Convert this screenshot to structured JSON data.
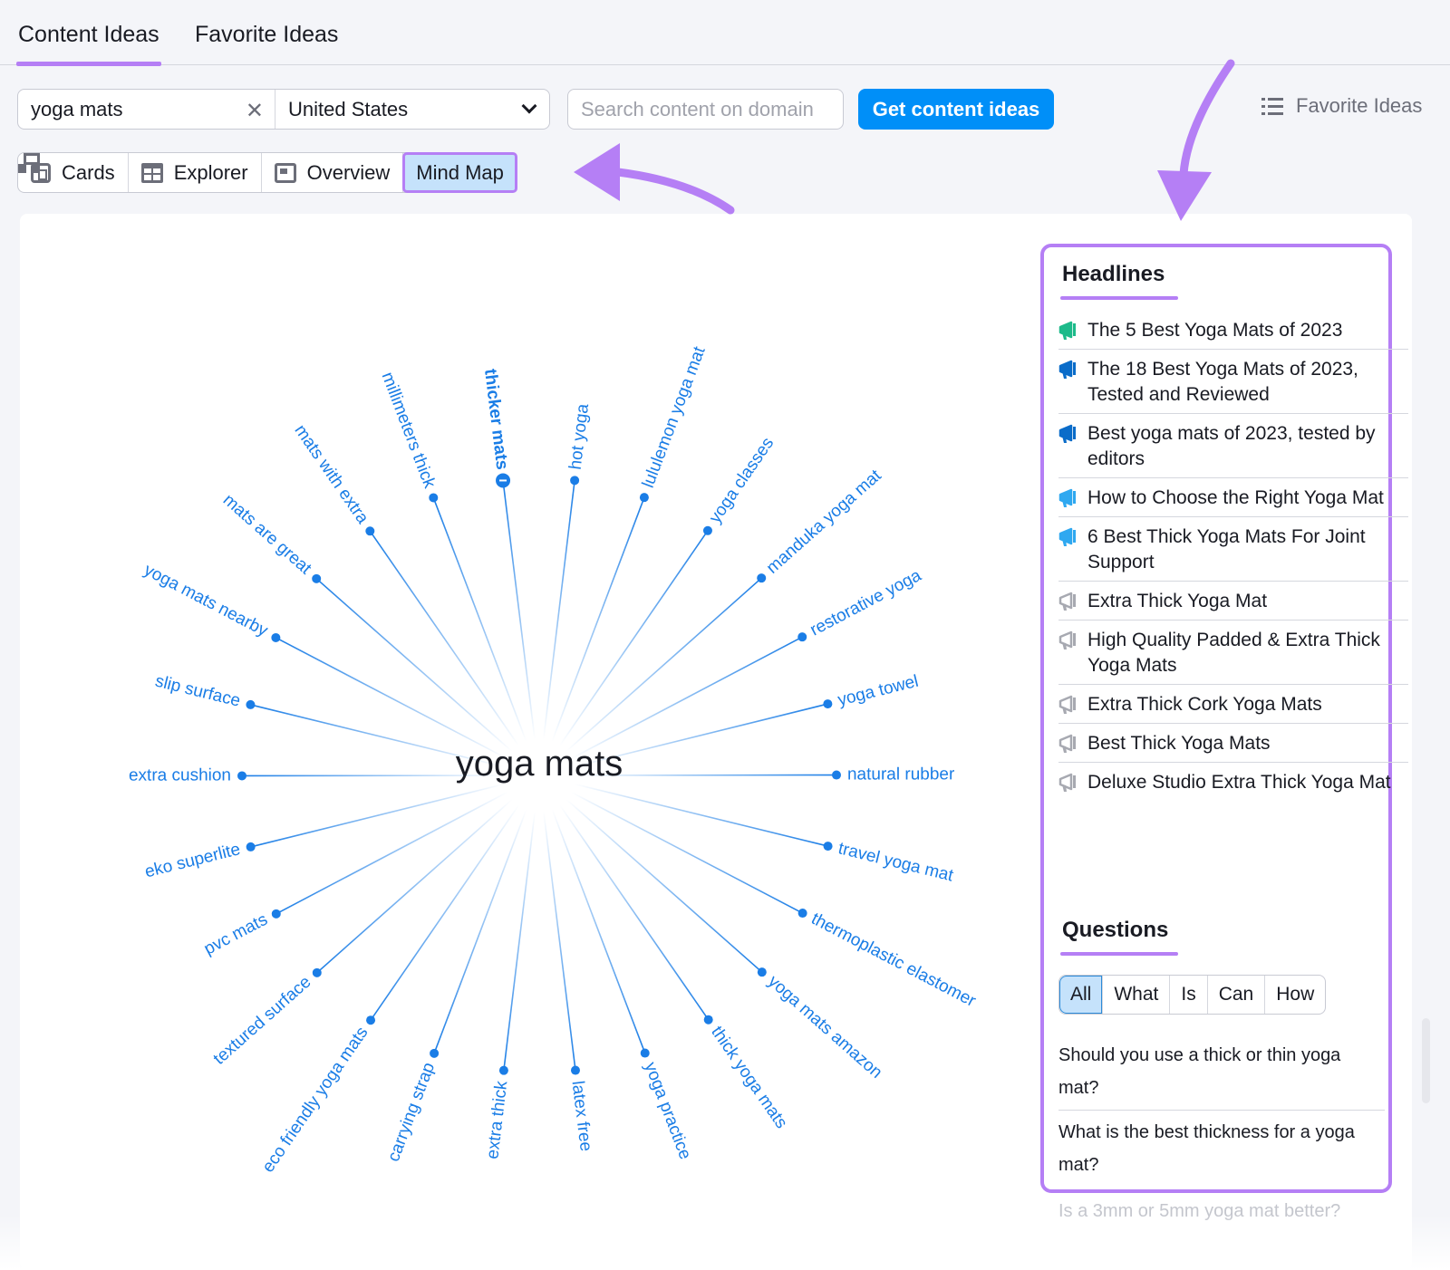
{
  "tabs": [
    {
      "label": "Content Ideas",
      "active": true
    },
    {
      "label": "Favorite Ideas",
      "active": false
    }
  ],
  "search": {
    "keyword": "yoga mats",
    "country": "United States",
    "domain_placeholder": "Search content on domain",
    "submit_label": "Get content ideas"
  },
  "favorite_link": {
    "label": "Favorite Ideas",
    "icon": "list-icon"
  },
  "views": [
    {
      "label": "Cards",
      "icon": "cards-icon",
      "active": false
    },
    {
      "label": "Explorer",
      "icon": "table-icon",
      "active": false
    },
    {
      "label": "Overview",
      "icon": "overview-icon",
      "active": false
    },
    {
      "label": "Mind Map",
      "icon": "mind-map-icon",
      "active": true
    }
  ],
  "annotation_color": "#b57ff5",
  "mindmap": {
    "center": "yoga mats",
    "node_color": "#1a7de6",
    "expanded_node": "thicker mats",
    "nodes": [
      "thicker mats",
      "hot yoga",
      "lululemon yoga mat",
      "yoga classes",
      "manduka yoga mat",
      "restorative yoga",
      "yoga towel",
      "natural rubber",
      "travel yoga mat",
      "thermoplastic elastomer",
      "yoga mats amazon",
      "thick yoga mats",
      "yoga practice",
      "latex free",
      "extra thick",
      "carrying strap",
      "eco friendly yoga mats",
      "textured surface",
      "pvc mats",
      "eko superlite",
      "extra cushion",
      "slip surface",
      "yoga mats nearby",
      "mats are great",
      "mats with extra",
      "millimeters thick"
    ]
  },
  "headlines": {
    "title": "Headlines",
    "items": [
      {
        "text": "The 5 Best Yoga Mats of 2023",
        "icon_color": "#1dba8a"
      },
      {
        "text": "The 18 Best Yoga Mats of 2023, Tested and Reviewed",
        "icon_color": "#0a6cc9"
      },
      {
        "text": "Best yoga mats of 2023, tested by editors",
        "icon_color": "#0a6cc9"
      },
      {
        "text": "How to Choose the Right Yoga Mat",
        "icon_color": "#2fa8f0"
      },
      {
        "text": "6 Best Thick Yoga Mats For Joint Support",
        "icon_color": "#2fa8f0"
      },
      {
        "text": "Extra Thick Yoga Mat",
        "icon_color": "#a7a9b1"
      },
      {
        "text": "High Quality Padded & Extra Thick Yoga Mats",
        "icon_color": "#a7a9b1"
      },
      {
        "text": "Extra Thick Cork Yoga Mats",
        "icon_color": "#a7a9b1"
      },
      {
        "text": "Best Thick Yoga Mats",
        "icon_color": "#a7a9b1"
      },
      {
        "text": "Deluxe Studio Extra Thick Yoga Mat",
        "icon_color": "#a7a9b1"
      }
    ]
  },
  "questions": {
    "title": "Questions",
    "filters": [
      {
        "label": "All",
        "active": true
      },
      {
        "label": "What",
        "active": false
      },
      {
        "label": "Is",
        "active": false
      },
      {
        "label": "Can",
        "active": false
      },
      {
        "label": "How",
        "active": false
      }
    ],
    "items": [
      "Should you use a thick or thin yoga mat?",
      "What is the best thickness for a yoga mat?"
    ],
    "faded_item": "Is a 3mm or 5mm yoga mat better?"
  }
}
